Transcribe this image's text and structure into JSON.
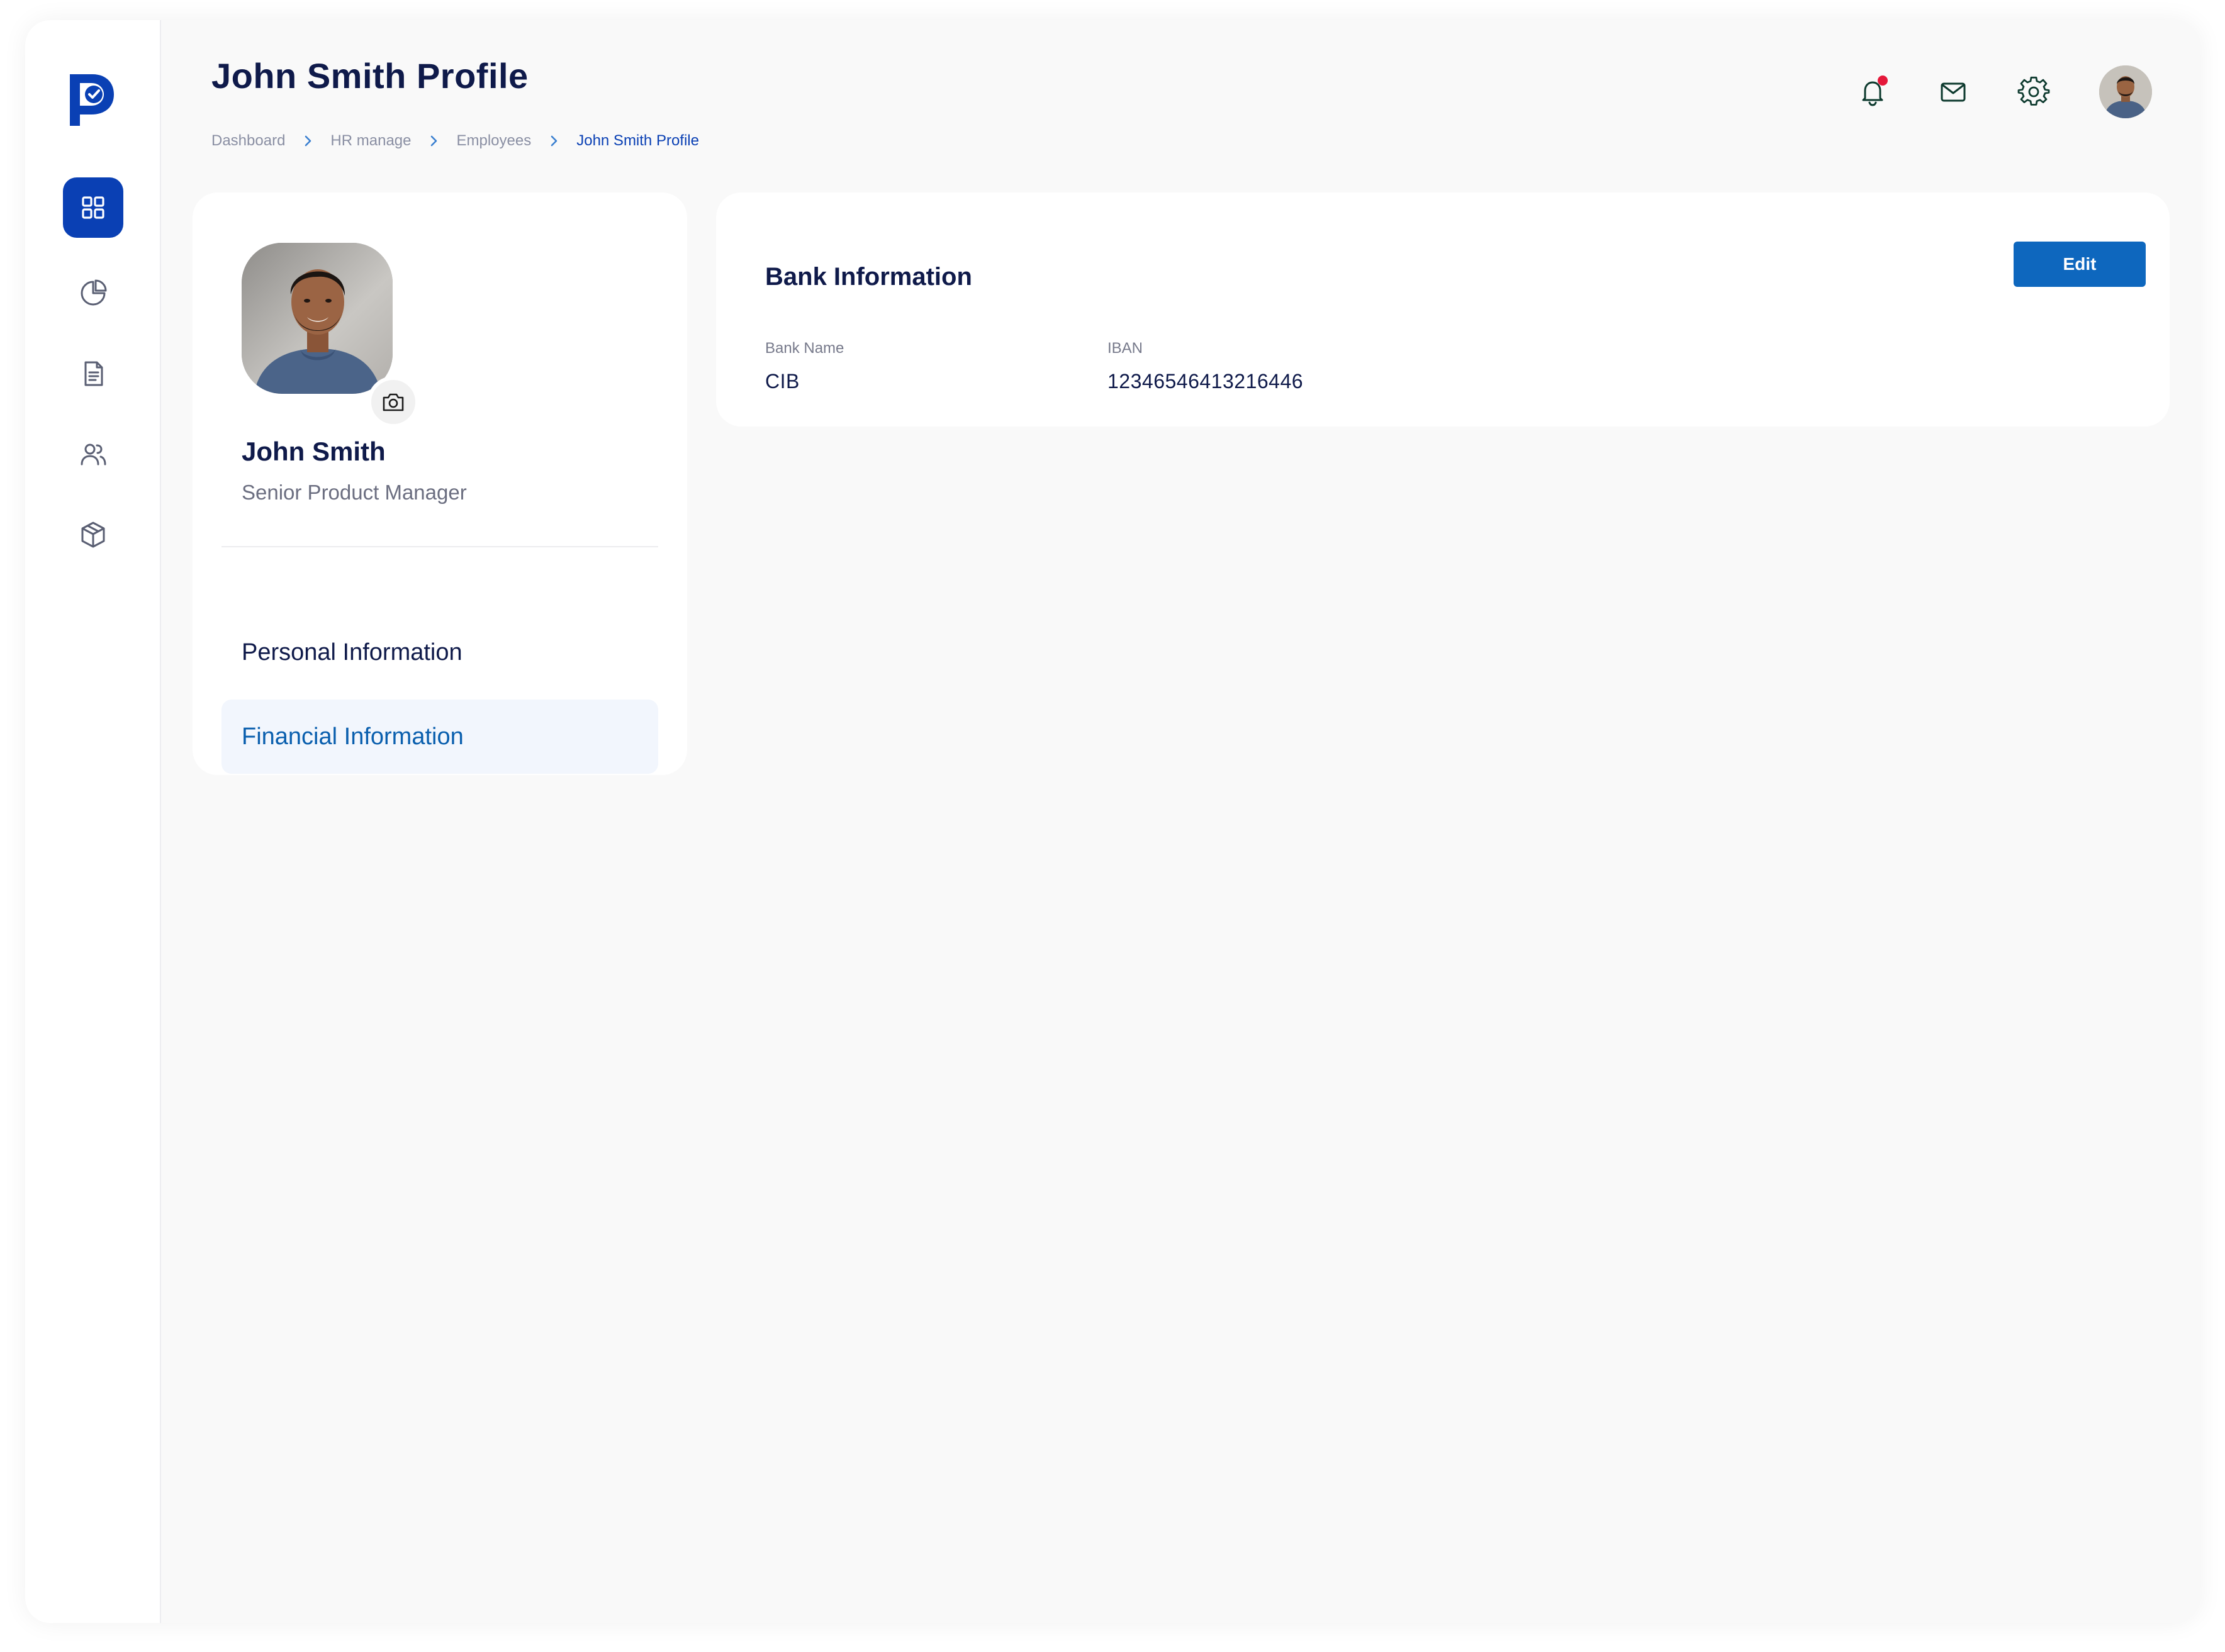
{
  "header": {
    "title": "John Smith Profile",
    "breadcrumb": [
      "Dashboard",
      "HR manage",
      "Employees",
      "John Smith Profile"
    ]
  },
  "sidebar": {
    "items": [
      {
        "icon": "grid-icon",
        "active": true
      },
      {
        "icon": "pie-chart-icon",
        "active": false
      },
      {
        "icon": "document-icon",
        "active": false
      },
      {
        "icon": "users-icon",
        "active": false
      },
      {
        "icon": "box-icon",
        "active": false
      }
    ]
  },
  "topbar": {
    "icons": [
      "bell-icon",
      "mail-icon",
      "gear-icon",
      "avatar"
    ],
    "has_notification": true
  },
  "profile": {
    "name": "John Smith",
    "role": "Senior Product Manager",
    "menu": [
      "Personal Information",
      "Financial Information"
    ],
    "active_menu": "Financial Information"
  },
  "bank": {
    "title": "Bank Information",
    "edit_label": "Edit",
    "fields": [
      {
        "label": "Bank Name",
        "value": "CIB"
      },
      {
        "label": "IBAN",
        "value": "12346546413216446"
      }
    ]
  },
  "colors": {
    "primary": "#0a40b4",
    "button": "#0e67be",
    "active_text": "#0a5fae",
    "notification": "#e5183a",
    "icon_green": "#0d3a2e",
    "background": "#f9f9f9"
  }
}
